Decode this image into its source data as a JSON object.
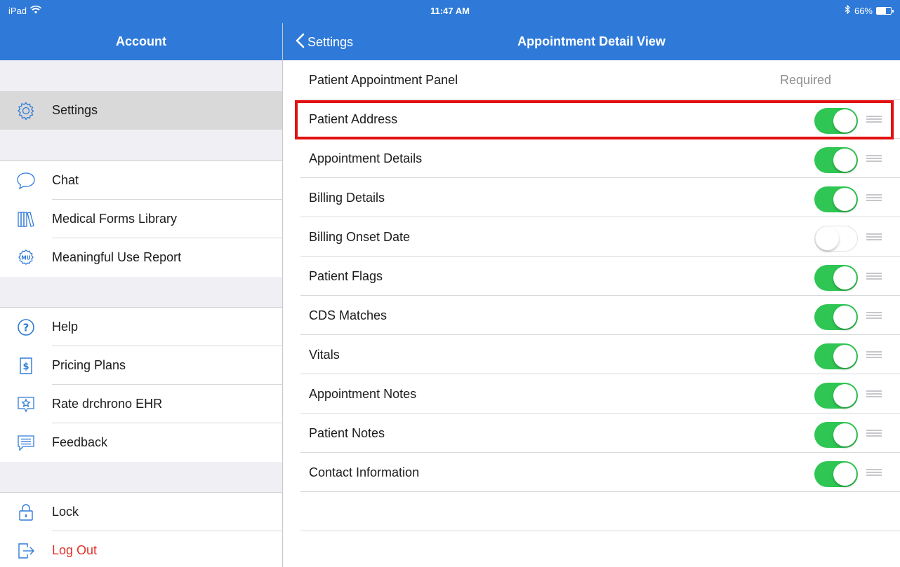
{
  "status_bar": {
    "device": "iPad",
    "time": "11:47 AM",
    "battery": "66%",
    "battery_level": 0.66
  },
  "sidebar": {
    "title": "Account",
    "items": [
      {
        "label": "Settings",
        "icon": "gear-icon",
        "selected": true
      },
      {
        "label": "Chat",
        "icon": "chat-bubble-icon"
      },
      {
        "label": "Medical Forms Library",
        "icon": "library-books-icon"
      },
      {
        "label": "Meaningful Use Report",
        "icon": "mu-badge-icon"
      },
      {
        "label": "Help",
        "icon": "question-circle-icon"
      },
      {
        "label": "Pricing Plans",
        "icon": "dollar-tag-icon"
      },
      {
        "label": "Rate drchrono EHR",
        "icon": "star-box-icon"
      },
      {
        "label": "Feedback",
        "icon": "feedback-message-icon"
      },
      {
        "label": "Lock",
        "icon": "padlock-icon"
      },
      {
        "label": "Log Out",
        "icon": "logout-arrow-icon"
      }
    ]
  },
  "main": {
    "back_label": "Settings",
    "title": "Appointment Detail View",
    "rows": [
      {
        "label": "Patient Appointment Panel",
        "required_label": "Required"
      },
      {
        "label": "Patient Address",
        "enabled": true,
        "highlighted": true
      },
      {
        "label": "Appointment Details",
        "enabled": true
      },
      {
        "label": "Billing Details",
        "enabled": true
      },
      {
        "label": "Billing Onset Date",
        "enabled": false
      },
      {
        "label": "Patient Flags",
        "enabled": true
      },
      {
        "label": "CDS Matches",
        "enabled": true
      },
      {
        "label": "Vitals",
        "enabled": true
      },
      {
        "label": "Appointment Notes",
        "enabled": true
      },
      {
        "label": "Patient Notes",
        "enabled": true
      },
      {
        "label": "Contact Information",
        "enabled": true
      }
    ]
  },
  "colors": {
    "nav_blue": "#2f7ad8",
    "toggle_on": "#2fc653",
    "highlight_red": "#e31010",
    "logout_red": "#e0322b"
  }
}
